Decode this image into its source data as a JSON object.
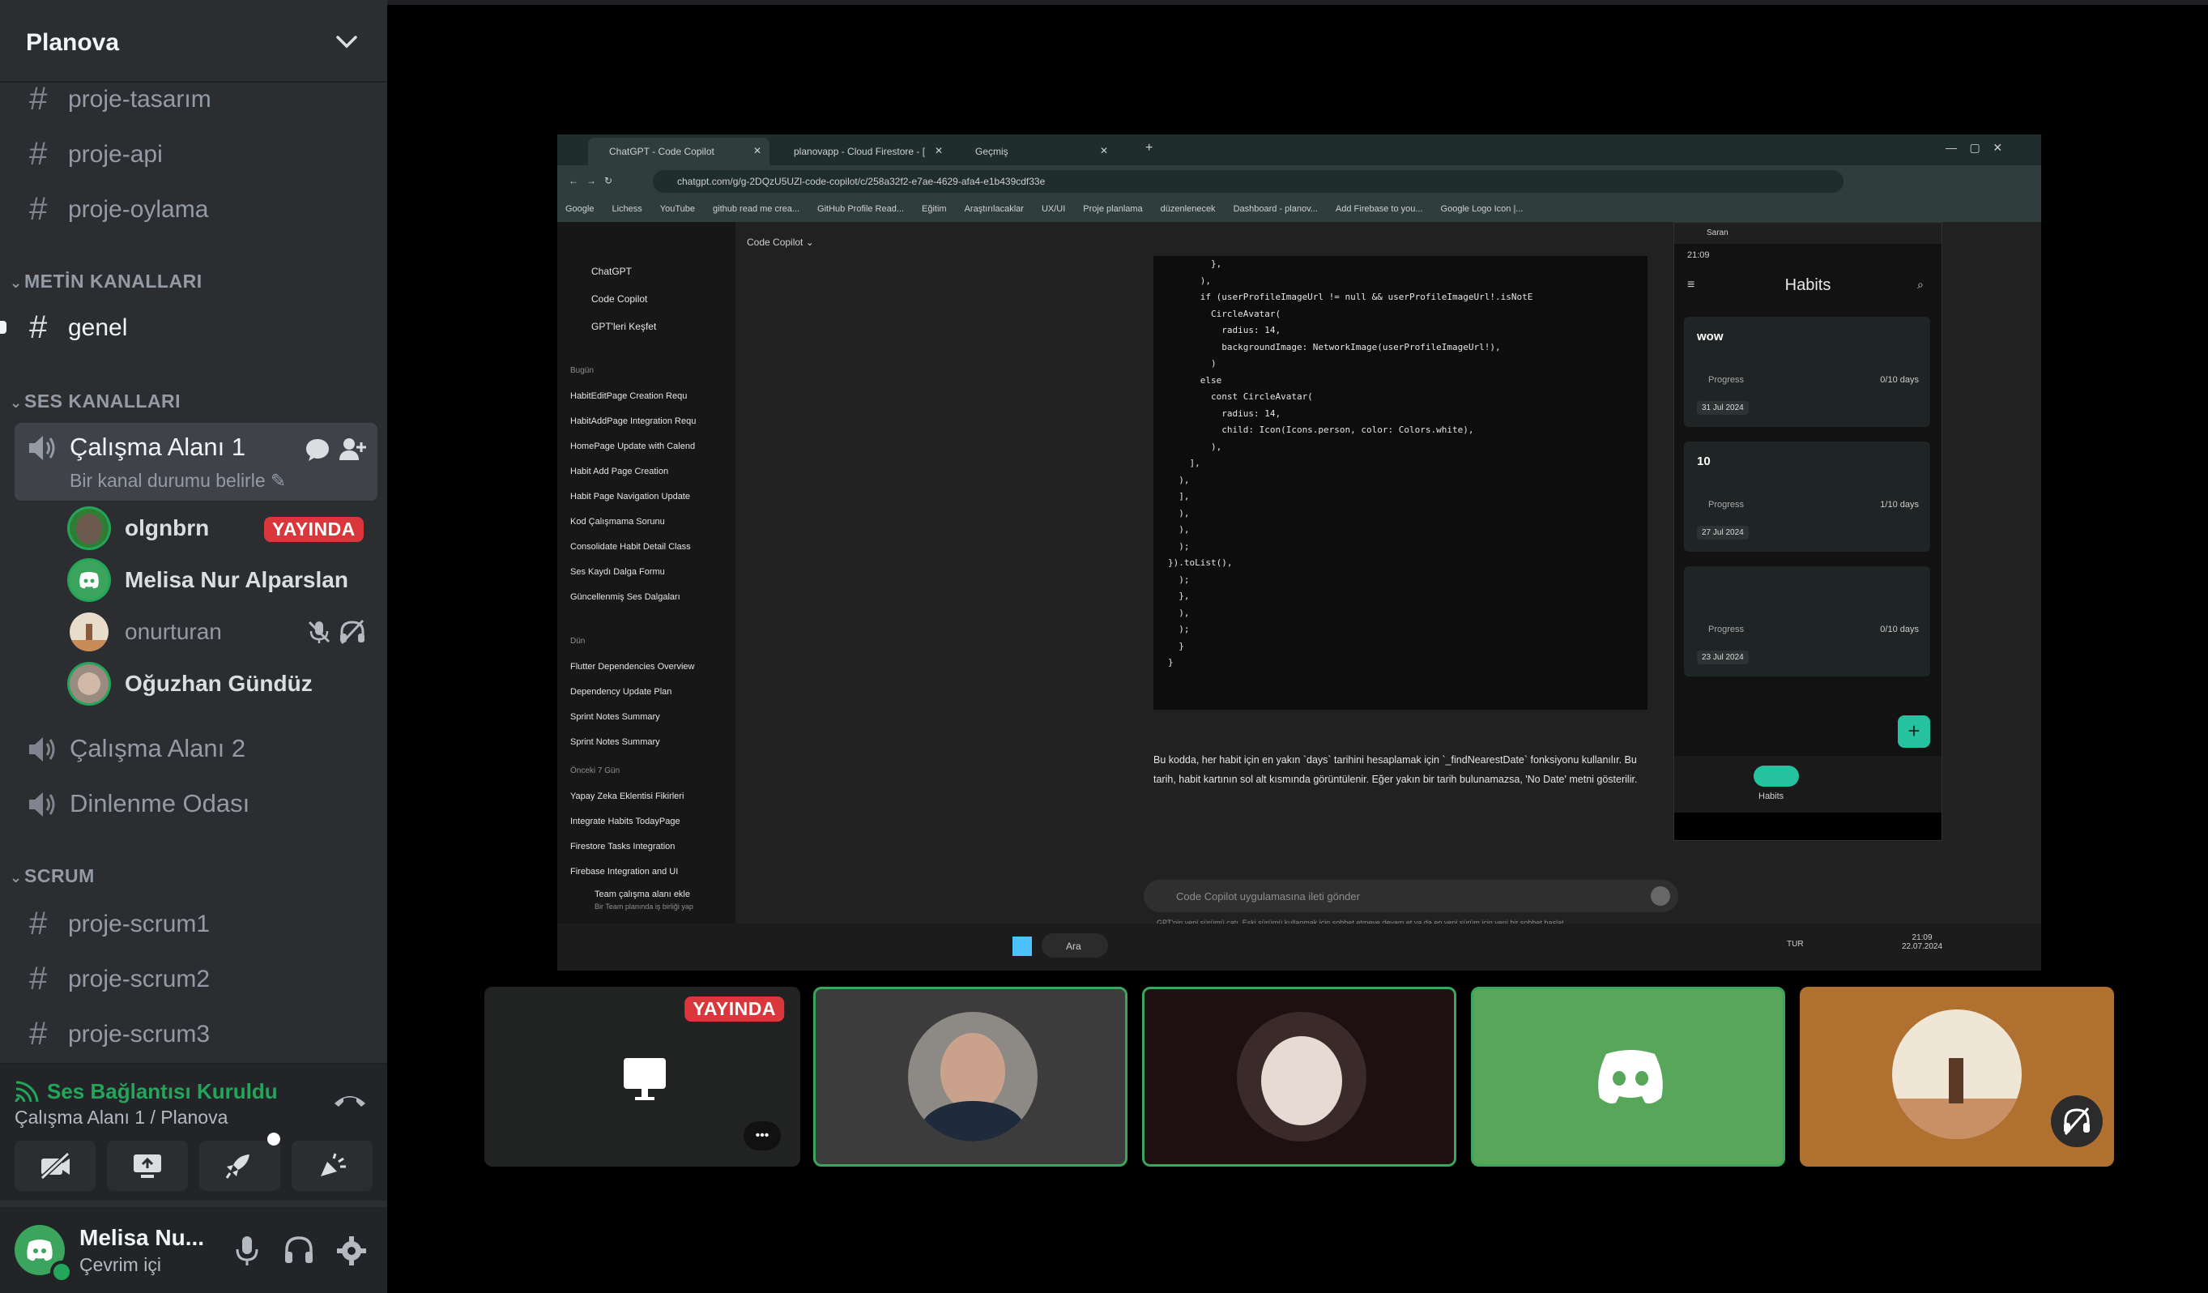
{
  "server": {
    "name": "Planova"
  },
  "text_channels_top": [
    {
      "name": "proje-tasarım"
    },
    {
      "name": "proje-api"
    },
    {
      "name": "proje-oylama"
    }
  ],
  "categories": {
    "metin": "METİN KANALLARI",
    "ses": "SES KANALLARI",
    "scrum": "SCRUM"
  },
  "metin_channels": [
    {
      "name": "genel"
    }
  ],
  "voice_channels": [
    {
      "name": "Çalışma Alanı 1",
      "status": "Bir kanal durumu belirle"
    },
    {
      "name": "Çalışma Alanı 2"
    },
    {
      "name": "Dinlenme Odası"
    }
  ],
  "members": [
    {
      "name": "olgnbrn",
      "badge": "YAYINDA"
    },
    {
      "name": "Melisa Nur Alparslan"
    },
    {
      "name": "onurturan"
    },
    {
      "name": "Oğuzhan Gündüz"
    }
  ],
  "scrum_channels": [
    {
      "name": "proje-scrum1"
    },
    {
      "name": "proje-scrum2"
    },
    {
      "name": "proje-scrum3"
    }
  ],
  "voice_connection": {
    "title": "Ses Bağlantısı Kuruldu",
    "subtitle": "Çalışma Alanı 1 / Planova"
  },
  "user": {
    "name": "Melisa Nu...",
    "status": "Çevrim içi"
  },
  "stream_tile": {
    "badge": "YAYINDA",
    "more": "•••"
  },
  "shared_screen": {
    "tabs": [
      "ChatGPT - Code Copilot",
      "planovapp - Cloud Firestore - [",
      "Geçmiş"
    ],
    "url": "chatgpt.com/g/g-2DQzU5UZl-code-copilot/c/258a32f2-e7ae-4629-afa4-e1b439cdf33e",
    "bookmarks": [
      "Google",
      "Lichess",
      "YouTube",
      "github read me crea...",
      "GitHub Profile Read...",
      "Eğitim",
      "Araştırılacaklar",
      "UX/UI",
      "Proje planlama",
      "düzenlenecek",
      "Dashboard - planov...",
      "Add Firebase to you...",
      "Google Logo Icon |..."
    ],
    "gpt_menu": [
      "ChatGPT",
      "Code Copilot",
      "GPT'leri Keşfet"
    ],
    "today_label": "Bugün",
    "today_items": [
      "HabitEditPage Creation Requ",
      "HabitAddPage Integration Requ",
      "HomePage Update with Calend",
      "Habit Add Page Creation",
      "Habit Page Navigation Update",
      "Kod Çalışmama Sorunu",
      "Consolidate Habit Detail Class",
      "Ses Kaydı Dalga Formu",
      "Güncellenmiş Ses Dalgaları"
    ],
    "yesterday_label": "Dün",
    "yesterday_items": [
      "Flutter Dependencies Overview",
      "Dependency Update Plan",
      "Sprint Notes Summary",
      "Sprint Notes Summary"
    ],
    "week_label": "Önceki 7 Gün",
    "week_items": [
      "Yapay Zeka Eklentisi Fikirleri",
      "Integrate Habits TodayPage",
      "Firestore Tasks Integration",
      "Firebase Integration and UI"
    ],
    "team_title": "Team çalışma alanı ekle",
    "team_sub": "Bir Team planında iş birliği yap",
    "model_label": "Code Copilot",
    "code_lines": [
      "        },",
      "      ),",
      "      if (userProfileImageUrl != null && userProfileImageUrl!.isNotE",
      "        CircleAvatar(",
      "          radius: 14,",
      "          backgroundImage: NetworkImage(userProfileImageUrl!),",
      "        )",
      "      else",
      "        const CircleAvatar(",
      "          radius: 14,",
      "          child: Icon(Icons.person, color: Colors.white),",
      "        ),",
      "    ],",
      "  ),",
      "  ],",
      "  ),",
      "  ),",
      "  );",
      "}).toList(),",
      "  );",
      "  },",
      "  ),",
      "  );",
      "  }",
      "}"
    ],
    "explanation": "Bu kodda, her habit için en yakın `days` tarihini hesaplamak için `_findNearestDate` fonksiyonu kullanılır. Bu tarih, habit kartının sol alt kısmında görüntülenir. Eğer yakın bir tarih bulunamazsa, 'No Date' metni gösterilir.",
    "input_placeholder": "Code Copilot uygulamasına ileti gönder",
    "footer_note": "GPT'nin yeni sürümü çatı. Eski sürümü kullanmak için sohbet etmeye devam et ya da en yeni sürüm için yeni bir sohbet başlat.",
    "phone": {
      "window_title": "Saran",
      "time": "21:09",
      "app_title": "Habits",
      "habits": [
        {
          "title": "wow",
          "progress_label": "Progress",
          "progress": "0/10 days",
          "date": "31 Jul 2024"
        },
        {
          "title": "10",
          "progress_label": "Progress",
          "progress": "1/10 days",
          "date": "27 Jul 2024"
        },
        {
          "title": "",
          "progress_label": "Progress",
          "progress": "0/10 days",
          "date": "23 Jul 2024"
        }
      ],
      "nav_active": "Habits"
    },
    "taskbar": {
      "search": "Ara",
      "lang": "TUR",
      "time": "21:09",
      "date": "22.07.2024"
    }
  }
}
